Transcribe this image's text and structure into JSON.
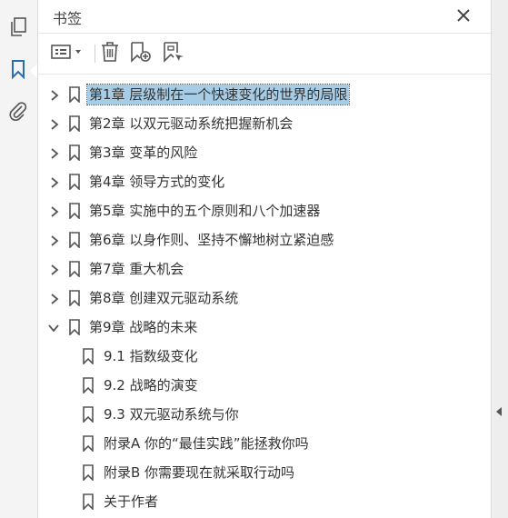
{
  "panel": {
    "title": "书签"
  },
  "icons": {
    "rail": [
      "pages-icon",
      "bookmarks-icon",
      "attachments-icon"
    ],
    "toolbar": [
      "options-menu-icon",
      "delete-bookmark-icon",
      "new-bookmark-icon",
      "new-bookmark-from-structure-icon"
    ],
    "close": "close-icon"
  },
  "colors": {
    "selection": "#a7cde6",
    "accent": "#2b6cb0"
  },
  "bookmarks": [
    {
      "label": "第1章  层级制在一个快速变化的世界的局限",
      "expander": "collapsed",
      "selected": true
    },
    {
      "label": "第2章  以双元驱动系统把握新机会",
      "expander": "collapsed"
    },
    {
      "label": "第3章  变革的风险",
      "expander": "collapsed"
    },
    {
      "label": "第4章  领导方式的变化",
      "expander": "collapsed"
    },
    {
      "label": "第5章  实施中的五个原则和八个加速器",
      "expander": "collapsed"
    },
    {
      "label": "第6章  以身作则、坚持不懈地树立紧迫感",
      "expander": "collapsed"
    },
    {
      "label": "第7章  重大机会",
      "expander": "collapsed"
    },
    {
      "label": "第8章  创建双元驱动系统",
      "expander": "collapsed"
    },
    {
      "label": "第9章  战略的未来",
      "expander": "expanded"
    },
    {
      "label": "9.1  指数级变化",
      "expander": "none"
    },
    {
      "label": "9.2  战略的演变",
      "expander": "none"
    },
    {
      "label": "9.3  双元驱动系统与你",
      "expander": "none"
    },
    {
      "label": "附录A  你的“最佳实践”能拯救你吗",
      "expander": "none"
    },
    {
      "label": "附录B  你需要现在就采取行动吗",
      "expander": "none"
    },
    {
      "label": "关于作者",
      "expander": "none"
    }
  ]
}
